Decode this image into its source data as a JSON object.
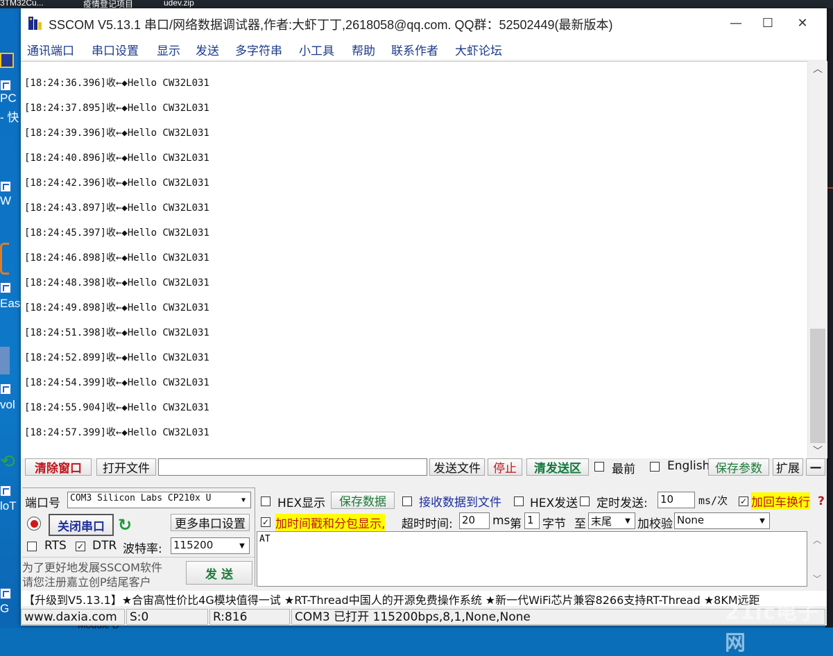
{
  "desktop": {
    "taskbar_titles": [
      "3TM32Cu...",
      "疫情登记项目",
      "udev.zip"
    ],
    "icon_labels": [
      "PC",
      "- 快",
      "W",
      "Eas",
      "vol",
      "loT",
      "G"
    ],
    "below_window_text": "Module D",
    "watermark": "21ic电子网"
  },
  "window": {
    "title": "SSCOM V5.13.1 串口/网络数据调试器,作者:大虾丁丁,2618058@qq.com. QQ群：52502449(最新版本)",
    "min_symbol": "—",
    "max_symbol": "☐",
    "close_symbol": "✕"
  },
  "menu": {
    "items": [
      "通讯端口",
      "串口设置",
      "显示",
      "发送",
      "多字符串",
      "小工具",
      "帮助",
      "联系作者",
      "大虾论坛"
    ]
  },
  "receive": {
    "lines": [
      "[18:24:36.396]收←◆Hello CW32L031",
      "[18:24:37.895]收←◆Hello CW32L031",
      "[18:24:39.396]收←◆Hello CW32L031",
      "[18:24:40.896]收←◆Hello CW32L031",
      "[18:24:42.396]收←◆Hello CW32L031",
      "[18:24:43.897]收←◆Hello CW32L031",
      "[18:24:45.397]收←◆Hello CW32L031",
      "[18:24:46.898]收←◆Hello CW32L031",
      "[18:24:48.398]收←◆Hello CW32L031",
      "[18:24:49.898]收←◆Hello CW32L031",
      "[18:24:51.398]收←◆Hello CW32L031",
      "[18:24:52.899]收←◆Hello CW32L031",
      "[18:24:54.399]收←◆Hello CW32L031",
      "[18:24:55.904]收←◆Hello CW32L031",
      "[18:24:57.399]收←◆Hello CW32L031"
    ]
  },
  "toolbar": {
    "clear_window": "清除窗口",
    "open_file": "打开文件",
    "file_path": "",
    "send_file": "发送文件",
    "stop": "停止",
    "clear_send": "清发送区",
    "front_label": "最前",
    "english_label": "English",
    "save_params": "保存参数",
    "expand": "扩展",
    "collapse": "—"
  },
  "port": {
    "port_label": "端口号",
    "port_value": "COM3 Silicon Labs CP210x U",
    "close_port": "关闭串口",
    "more_settings": "更多串口设置",
    "rts_label": "RTS",
    "dtr_label": "DTR",
    "baud_label": "波特率:",
    "baud_value": "115200",
    "promo_line1": "为了更好地发展SSCOM软件",
    "promo_line2": "请您注册嘉立创P结尾客户"
  },
  "options": {
    "hex_display": "HEX显示",
    "save_data": "保存数据",
    "recv_to_file": "接收数据到文件",
    "hex_send": "HEX发送",
    "timed_send": "定时发送:",
    "timed_value": "10",
    "timed_unit": "ms/次",
    "add_crlf": "加回车换行",
    "timestamp": "加时间戳和分包显示,",
    "timeout_label": "超时时间:",
    "timeout_value": "20",
    "timeout_unit": "ms",
    "byte_prefix": "第",
    "byte_value": "1",
    "byte_label": "字节",
    "to_label": "至",
    "end_value": "末尾",
    "checksum_label": "加校验",
    "checksum_value": "None",
    "send_button": "发  送",
    "send_text": "AT"
  },
  "ticker": "【升级到V5.13.1】★合宙高性价比4G模块值得一试 ★RT-Thread中国人的开源免费操作系统 ★新一代WiFi芯片兼容8266支持RT-Thread ★8KM远距",
  "status": {
    "website": "www.daxia.com",
    "sent": "S:0",
    "received": "R:816",
    "port_status": "COM3 已打开  115200bps,8,1,None,None"
  },
  "colors": {
    "accent_red": "#c0141b",
    "accent_green": "#1d7a3a",
    "highlight_yellow": "#ffff00",
    "menu_blue": "#1b3a8a"
  }
}
